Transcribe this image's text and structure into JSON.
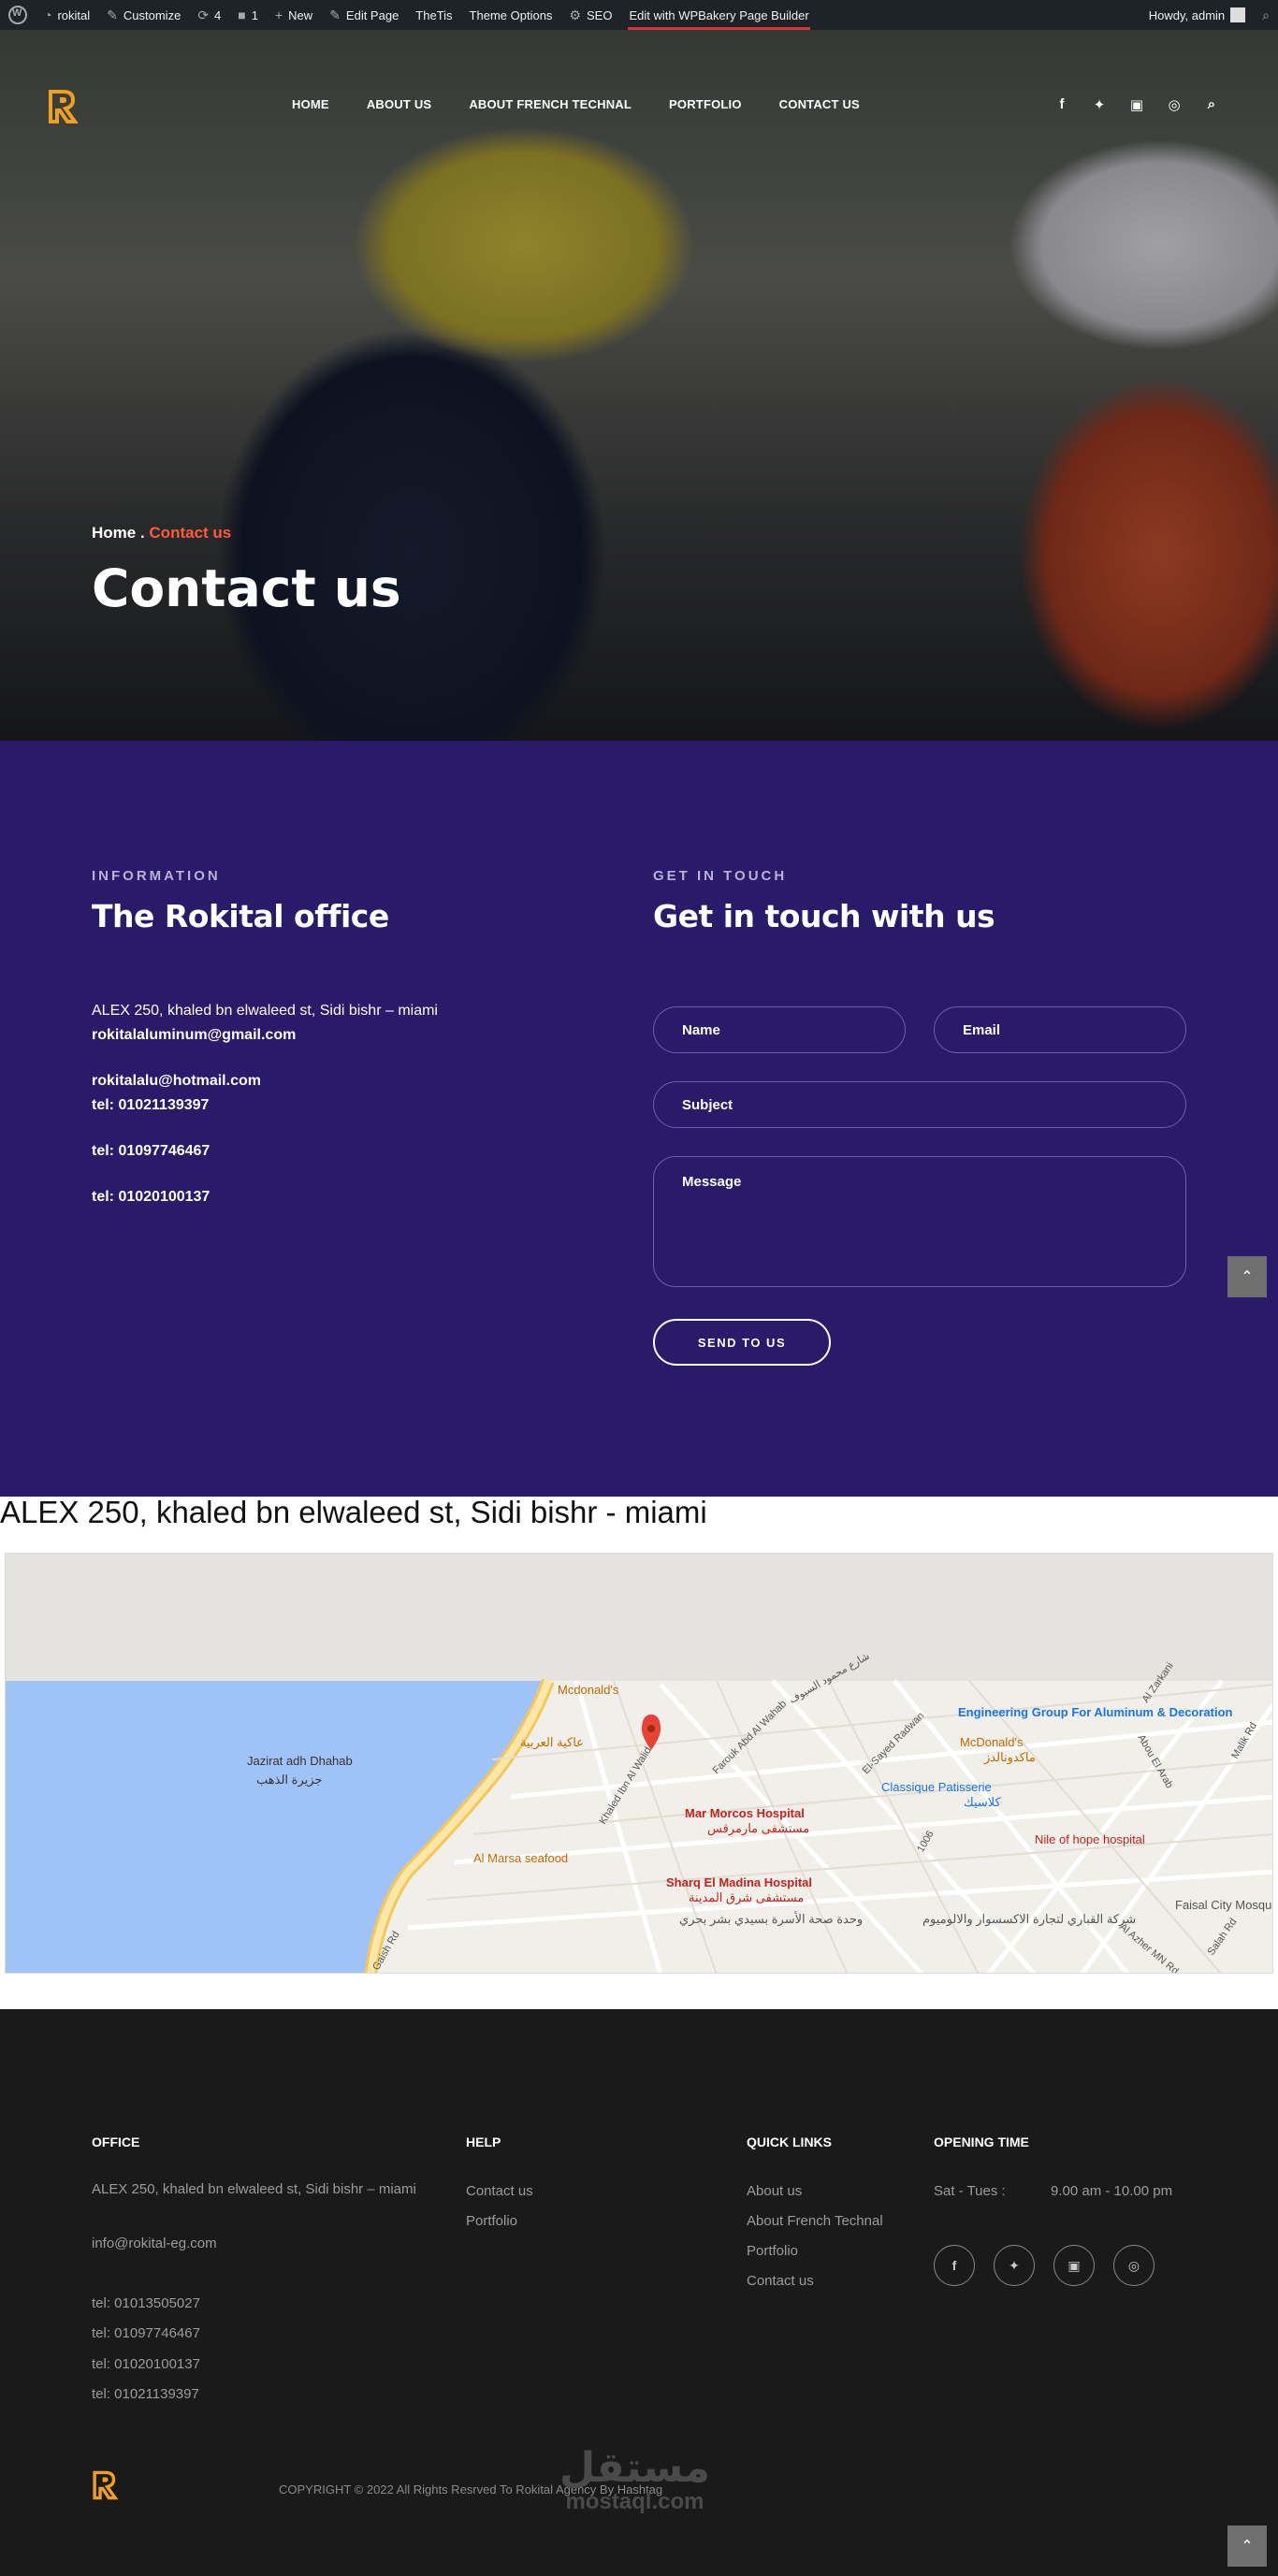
{
  "adminbar": {
    "site": "rokital",
    "customize": "Customize",
    "updates_count": "4",
    "comments_count": "1",
    "new": "New",
    "edit_page": "Edit Page",
    "thetis": "TheTis",
    "theme_options": "Theme Options",
    "seo": "SEO",
    "wpbakery": "Edit with WPBakery Page Builder",
    "howdy": "Howdy, admin"
  },
  "nav": {
    "items": [
      "HOME",
      "ABOUT US",
      "ABOUT FRENCH TECHNAL",
      "PORTFOLIO",
      "CONTACT US"
    ],
    "social": [
      "f",
      "t",
      "v",
      "ig",
      "search"
    ]
  },
  "hero": {
    "breadcrumb_home": "Home",
    "breadcrumb_sep": " . ",
    "breadcrumb_current": "Contact us",
    "title": "Contact us"
  },
  "info": {
    "eyebrow": "INFORMATION",
    "title": "The Rokital office",
    "address": "ALEX 250, khaled bn elwaleed st, Sidi bishr – miami",
    "email1": "rokitalaluminum@gmail.com",
    "email2": "rokitalalu@hotmail.com",
    "tel1": "tel: 01021139397",
    "tel2": "tel: 01097746467",
    "tel3": "tel: 01020100137"
  },
  "form": {
    "eyebrow": "GET IN TOUCH",
    "title": "Get in touch with us",
    "name_placeholder": "Name",
    "email_placeholder": "Email",
    "subject_placeholder": "Subject",
    "message_placeholder": "Message",
    "submit": "SEND TO US"
  },
  "map": {
    "heading": "ALEX 250, khaled bn elwaleed st, Sidi bishr - miami",
    "labels": {
      "island": "Jazirat adh Dhahab",
      "island_ar": "جزيرة الذهب",
      "mcdonalds1": "Mcdonald's",
      "engineering": "Engineering Group For Aluminum & Decoration",
      "mcdonalds2": "McDonald's",
      "mcdonalds2_ar": "ماكدونالدز",
      "classique": "Classique Patisserie",
      "classique_ar": "كلاسيك",
      "marmorcos": "Mar Morcos Hospital",
      "marmorcos_ar": "مستشفى مارمرقس",
      "nile": "Nile of hope hospital",
      "almarsa": "Al Marsa seafood",
      "sharq": "Sharq El Madina Hospital",
      "sharq_ar": "مستشفى شرق المدينة",
      "faisal": "Faisal City Mosqu",
      "road_khaled": "Khaled Ibn Al Walid",
      "road_farouk": "Farouk Abd Al Wahab",
      "road_sayed": "El-Sayed Radwan",
      "road_1006": "1006",
      "road_abou": "Abou El Arab",
      "road_azhar": "Al Azher MN Rd",
      "road_salah": "Salah Rd",
      "road_malik": "Malik Rd",
      "road_zarkani": "Al Zarkani",
      "road_gaish": "Gaish Rd",
      "shop_ar": "شركة القباري لتجارة الاكسسوار والالوميوم",
      "health_ar": "وحدة صحة الأسرة بسيدي بشر بحري",
      "arabic_rest": "عاكية العربية",
      "street_ar": "شارع محمود السيوف"
    }
  },
  "footer": {
    "office_head": "OFFICE",
    "office_address": "ALEX 250, khaled bn elwaleed st, Sidi bishr – miami",
    "office_email": "info@rokital-eg.com",
    "tels": [
      "tel: 01013505027",
      "tel: 01097746467",
      "tel: 01020100137",
      "tel: 01021139397"
    ],
    "help_head": "HELP",
    "help_links": [
      "Contact us",
      "Portfolio"
    ],
    "quick_head": "QUICK LINKS",
    "quick_links": [
      "About us",
      "About French Technal",
      "Portfolio",
      "Contact us"
    ],
    "opening_head": "OPENING TIME",
    "opening_days": "Sat - Tues :",
    "opening_hours": "9.00 am - 10.00 pm",
    "social": [
      "f",
      "t",
      "v",
      "ig"
    ],
    "copyright": "COPYRIGHT © 2022 All Rights Resrved To Rokital Agency By Hashtag",
    "watermark_ar": "مستقل",
    "watermark_en": "mostaql.com"
  },
  "colors": {
    "accent": "#ff5a3c",
    "contact_bg": "#2a1a6a",
    "footer_bg": "#1a1a1a",
    "logo_orange": "#f0a020"
  }
}
